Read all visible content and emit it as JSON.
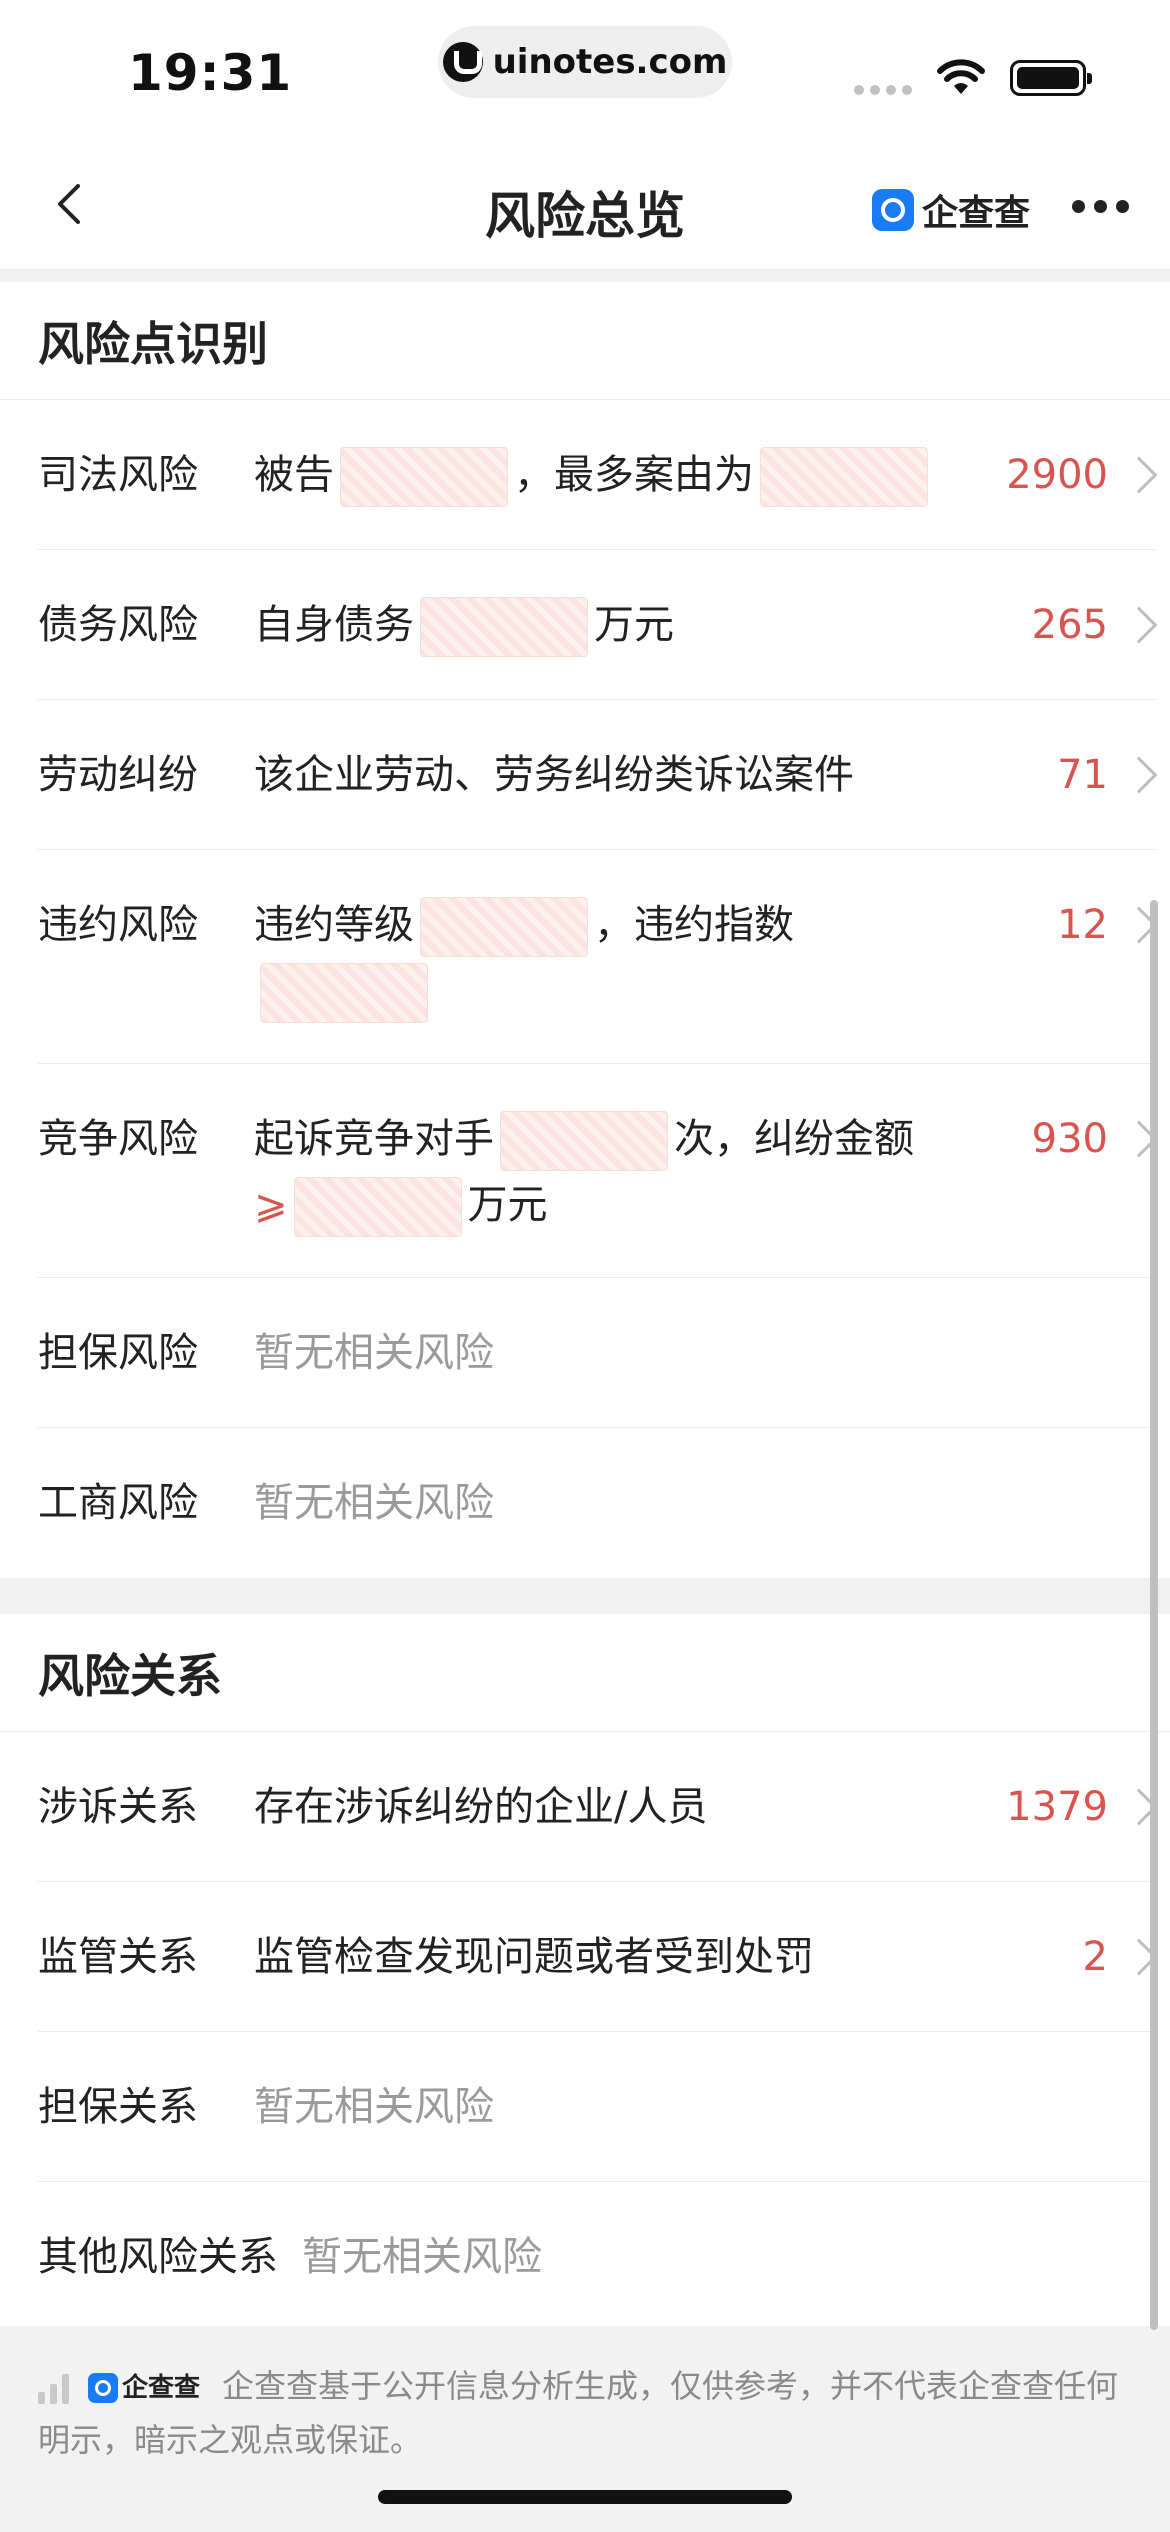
{
  "status_bar": {
    "time": "19:31",
    "url": "uinotes.com",
    "icons": [
      "signal-icon",
      "wifi-icon",
      "battery-icon"
    ]
  },
  "nav": {
    "title": "风险总览",
    "brand": "企查查",
    "icons": [
      "back-icon",
      "more-icon"
    ]
  },
  "risk_points": {
    "title": "风险点识别",
    "items": [
      {
        "label": "司法风险",
        "p1": "被告",
        "p2": "，最多案由为",
        "count": "2900"
      },
      {
        "label": "债务风险",
        "p1": "自身债务",
        "p2": "万元",
        "count": "265"
      },
      {
        "label": "劳动纠纷",
        "desc": "该企业劳动、劳务纠纷类诉讼案件",
        "count": "71"
      },
      {
        "label": "违约风险",
        "p1": "违约等级",
        "p2": "，违约指数",
        "count": "12"
      },
      {
        "label": "竞争风险",
        "p1": "起诉竞争对手",
        "p2": "次，纠纷金额",
        "sym": "⩾",
        "p3": "万元",
        "count": "930"
      },
      {
        "label": "担保风险",
        "desc": "暂无相关风险"
      },
      {
        "label": "工商风险",
        "desc": "暂无相关风险"
      }
    ]
  },
  "risk_relations": {
    "title": "风险关系",
    "items": [
      {
        "label": "涉诉关系",
        "desc": "存在涉诉纠纷的企业/人员",
        "count": "1379"
      },
      {
        "label": "监管关系",
        "desc": "监管检查发现问题或者受到处罚",
        "count": "2"
      },
      {
        "label": "担保关系",
        "desc": "暂无相关风险"
      },
      {
        "label": "其他风险关系",
        "desc": "暂无相关风险"
      }
    ]
  },
  "footer": {
    "brand": "企查查",
    "text": "企查查基于公开信息分析生成，仅供参考，并不代表企查查任何明示，暗示之观点或保证。"
  },
  "colors": {
    "accent_red": "#d9534f",
    "brand_blue": "#1a7cf5",
    "muted": "#9a9a9a"
  }
}
